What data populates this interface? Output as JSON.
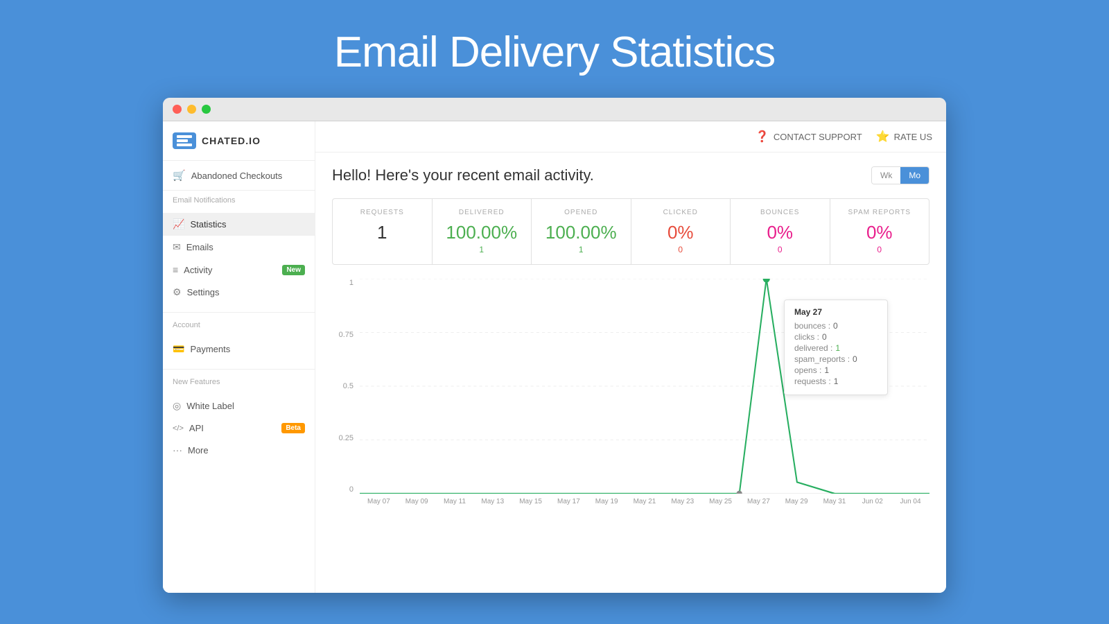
{
  "page": {
    "title": "Email Delivery Statistics"
  },
  "browser": {
    "traffic_lights": [
      "red",
      "yellow",
      "green"
    ]
  },
  "topbar": {
    "contact_support": "CONTACT SUPPORT",
    "rate_us": "RATE US"
  },
  "logo": {
    "text": "CHATED.IO"
  },
  "sidebar": {
    "abandoned_label": "Abandoned Checkouts",
    "email_notifications_label": "Email Notifications",
    "items": [
      {
        "id": "statistics",
        "label": "Statistics",
        "icon": "📈",
        "active": true
      },
      {
        "id": "emails",
        "label": "Emails",
        "icon": "✉"
      },
      {
        "id": "activity",
        "label": "Activity",
        "icon": "≡",
        "badge": "New"
      },
      {
        "id": "settings",
        "label": "Settings",
        "icon": "⚙"
      }
    ],
    "account_label": "Account",
    "account_items": [
      {
        "id": "payments",
        "label": "Payments",
        "icon": "💳"
      }
    ],
    "new_features_label": "New Features",
    "new_feature_items": [
      {
        "id": "white-label",
        "label": "White Label",
        "icon": "◎"
      },
      {
        "id": "api",
        "label": "API",
        "icon": "</>",
        "badge": "Beta"
      },
      {
        "id": "more",
        "label": "More",
        "icon": "···"
      }
    ]
  },
  "stats": {
    "heading": "Hello! Here's your recent email activity.",
    "period_wk": "Wk",
    "period_mo": "Mo",
    "cards": [
      {
        "label": "REQUESTS",
        "value": "1",
        "sub": "",
        "color": "black",
        "sub_color": ""
      },
      {
        "label": "DELIVERED",
        "value": "100.00%",
        "sub": "1",
        "color": "green",
        "sub_color": "green"
      },
      {
        "label": "OPENED",
        "value": "100.00%",
        "sub": "1",
        "color": "green",
        "sub_color": "green"
      },
      {
        "label": "CLICKED",
        "value": "0%",
        "sub": "0",
        "color": "red",
        "sub_color": "red"
      },
      {
        "label": "BOUNCES",
        "value": "0%",
        "sub": "0",
        "color": "pink",
        "sub_color": "pink"
      },
      {
        "label": "SPAM REPORTS",
        "value": "0%",
        "sub": "0",
        "color": "pink",
        "sub_color": "pink"
      }
    ]
  },
  "chart": {
    "y_labels": [
      "1",
      "0.75",
      "0.5",
      "0.25",
      "0"
    ],
    "x_labels": [
      "May 07",
      "May 09",
      "May 11",
      "May 13",
      "May 15",
      "May 17",
      "May 19",
      "May 21",
      "May 23",
      "May 25",
      "May 27",
      "May 29",
      "May 31",
      "Jun 02",
      "Jun 04"
    ],
    "tooltip": {
      "date": "May 27",
      "rows": [
        {
          "key": "bounces : ",
          "value": "0",
          "color": "default"
        },
        {
          "key": "clicks : ",
          "value": "0",
          "color": "default"
        },
        {
          "key": "delivered : ",
          "value": "1",
          "color": "green"
        },
        {
          "key": "spam_reports : ",
          "value": "0",
          "color": "default"
        },
        {
          "key": "opens : ",
          "value": "1",
          "color": "default"
        },
        {
          "key": "requests : ",
          "value": "1",
          "color": "default"
        }
      ]
    }
  }
}
